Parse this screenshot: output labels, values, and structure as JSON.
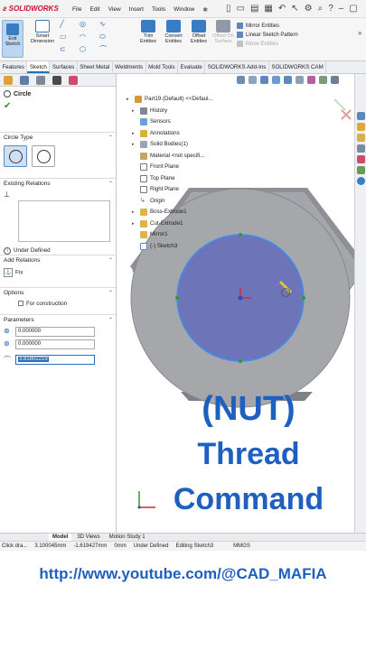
{
  "app": {
    "brand": "SOLIDWORKS"
  },
  "menu": [
    "File",
    "Edit",
    "View",
    "Insert",
    "Tools",
    "Window"
  ],
  "ribbon": {
    "exit_sketch": "Exit Sketch",
    "smart_dimension": "Smart Dimension",
    "trim_entities": "Trim Entities",
    "convert_entities": "Convert Entities",
    "offset_entities": "Offset Entities",
    "offset_on_surface": "Offset On Surface",
    "mirror_entities": "Mirror Entities",
    "linear_sketch_pattern": "Linear Sketch Pattern",
    "move_entities": "Move Entities"
  },
  "tabs": [
    "Features",
    "Sketch",
    "Surfaces",
    "Sheet Metal",
    "Weldments",
    "Mold Tools",
    "Evaluate",
    "SOLIDWORKS Add-Ins",
    "SOLIDWORKS CAM"
  ],
  "active_tab": "Sketch",
  "panel": {
    "title": "Circle",
    "circle_type_label": "Circle Type",
    "existing_relations_label": "Existing Relations",
    "under_defined": "Under Defined",
    "add_relations_label": "Add Relations",
    "fix_label": "Fix",
    "options_label": "Options",
    "for_construction": "For construction",
    "parameters_label": "Parameters",
    "cx": "0.000000",
    "cy": "0.000000",
    "radius": "3.81802219"
  },
  "tree": {
    "part": "Part19 (Default) <<Defaul...",
    "items": [
      "History",
      "Sensors",
      "Annotations",
      "Solid Bodies(1)",
      "Material <not specifi...",
      "Front Plane",
      "Top Plane",
      "Right Plane",
      "Origin",
      "Boss-Extrude1",
      "Cut-Extrude1",
      "Mirror1",
      "(-) Sketch3"
    ]
  },
  "overlay": {
    "line1": "(NUT)",
    "line2": "Thread",
    "line3": "Command"
  },
  "bottom_tabs": [
    "Model",
    "3D Views",
    "Motion Study 1"
  ],
  "status": {
    "hint": "Click dra...",
    "x": "3.100045mm",
    "y": "-1.619427mm",
    "z": "0mm",
    "state": "Under Defined",
    "editing": "Editing Sketch3",
    "units": "MMGS"
  },
  "url": "http://www.youtube.com/@CAD_MAFIA",
  "colors": {
    "accent": "#1e5fbf",
    "nut_grey": "#a4a6ab",
    "circle_fill": "#6e74b8"
  }
}
